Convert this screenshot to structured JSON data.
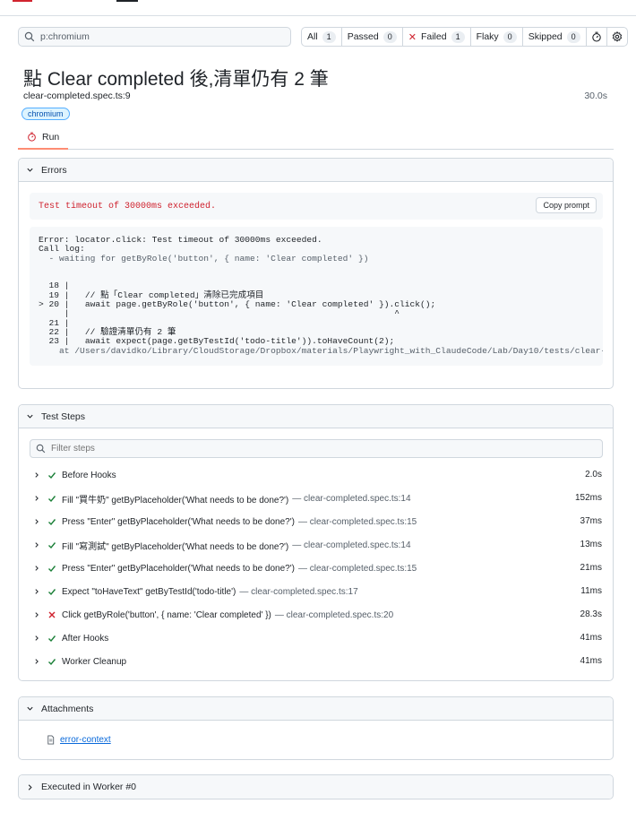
{
  "search": {
    "value": "p:chromium"
  },
  "filters": [
    {
      "label": "All",
      "count": "1"
    },
    {
      "label": "Passed",
      "count": "0"
    },
    {
      "label": "Failed",
      "count": "1"
    },
    {
      "label": "Flaky",
      "count": "0"
    },
    {
      "label": "Skipped",
      "count": "0"
    }
  ],
  "test": {
    "title": "點 Clear completed 後,清單仍有 2 筆",
    "location": "clear-completed.spec.ts:9",
    "duration": "30.0s",
    "project_tag": "chromium"
  },
  "tabs": [
    {
      "label": "Run"
    }
  ],
  "errors": {
    "header": "Errors",
    "message": "Test timeout of 30000ms exceeded.",
    "copy_label": "Copy prompt",
    "stack": [
      "Error: locator.click: Test timeout of 30000ms exceeded.",
      "Call log:",
      "  - waiting for getByRole('button', { name: 'Clear completed' })",
      "",
      "",
      "  18 |",
      "  19 |   // 點「Clear completed」清除已完成項目",
      "> 20 |   await page.getByRole('button', { name: 'Clear completed' }).click();",
      "     |                                                               ^",
      "  21 |",
      "  22 |   // 驗證清單仍有 2 筆",
      "  23 |   await expect(page.getByTestId('todo-title')).toHaveCount(2);",
      "    at /Users/davidko/Library/CloudStorage/Dropbox/materials/Playwright_with_ClaudeCode/Lab/Day10/tests/clear-"
    ]
  },
  "steps": {
    "header": "Test Steps",
    "filter_placeholder": "Filter steps",
    "items": [
      {
        "status": "passed",
        "text": "Before Hooks",
        "location": "",
        "time": "2.0s"
      },
      {
        "status": "passed",
        "text": "Fill \"買牛奶\" getByPlaceholder('What needs to be done?')",
        "location": "— clear-completed.spec.ts:14",
        "time": "152ms"
      },
      {
        "status": "passed",
        "text": "Press \"Enter\" getByPlaceholder('What needs to be done?')",
        "location": "— clear-completed.spec.ts:15",
        "time": "37ms"
      },
      {
        "status": "passed",
        "text": "Fill \"寫測試\" getByPlaceholder('What needs to be done?')",
        "location": "— clear-completed.spec.ts:14",
        "time": "13ms"
      },
      {
        "status": "passed",
        "text": "Press \"Enter\" getByPlaceholder('What needs to be done?')",
        "location": "— clear-completed.spec.ts:15",
        "time": "21ms"
      },
      {
        "status": "passed",
        "text": "Expect \"toHaveText\" getByTestId('todo-title')",
        "location": "— clear-completed.spec.ts:17",
        "time": "11ms"
      },
      {
        "status": "failed",
        "text": "Click getByRole('button', { name: 'Clear completed' })",
        "location": "— clear-completed.spec.ts:20",
        "time": "28.3s"
      },
      {
        "status": "passed",
        "text": "After Hooks",
        "location": "",
        "time": "41ms"
      },
      {
        "status": "passed",
        "text": "Worker Cleanup",
        "location": "",
        "time": "41ms"
      }
    ]
  },
  "attachments": {
    "header": "Attachments",
    "items": [
      {
        "name": "error-context"
      }
    ]
  },
  "worker": {
    "header": "Executed in Worker #0"
  },
  "colors": {
    "passed": "#1a7f37",
    "failed": "#cf222e",
    "link": "#0969da",
    "tab_accent": "#fd8c73"
  }
}
